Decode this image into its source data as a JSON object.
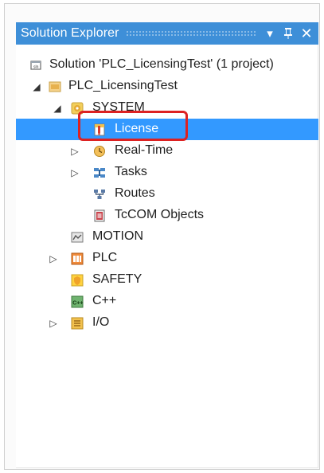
{
  "window": {
    "title": "Solution Explorer",
    "pin_icon": "pin-icon",
    "close_icon": "close-icon",
    "dropdown_icon": "dropdown-arrow-icon"
  },
  "tree": {
    "items": [
      {
        "label": "Solution 'PLC_LicensingTest' (1 project)",
        "icon": "solution-icon",
        "expander": ""
      },
      {
        "label": "PLC_LicensingTest",
        "icon": "project-icon",
        "expander": "◢"
      },
      {
        "label": "SYSTEM",
        "icon": "system-icon",
        "expander": "◢"
      },
      {
        "label": "License",
        "icon": "license-icon",
        "expander": "",
        "selected": true
      },
      {
        "label": "Real-Time",
        "icon": "realtime-icon",
        "expander": "▷"
      },
      {
        "label": "Tasks",
        "icon": "tasks-icon",
        "expander": "▷"
      },
      {
        "label": "Routes",
        "icon": "routes-icon",
        "expander": ""
      },
      {
        "label": "TcCOM Objects",
        "icon": "tccom-icon",
        "expander": ""
      },
      {
        "label": "MOTION",
        "icon": "motion-icon",
        "expander": ""
      },
      {
        "label": "PLC",
        "icon": "plc-icon",
        "expander": "▷"
      },
      {
        "label": "SAFETY",
        "icon": "safety-icon",
        "expander": ""
      },
      {
        "label": "C++",
        "icon": "cpp-icon",
        "expander": ""
      },
      {
        "label": "I/O",
        "icon": "io-icon",
        "expander": "▷"
      }
    ]
  },
  "colors": {
    "titlebar": "#3e8fd8",
    "selection": "#3399ff",
    "highlight_box": "#dd2222"
  }
}
